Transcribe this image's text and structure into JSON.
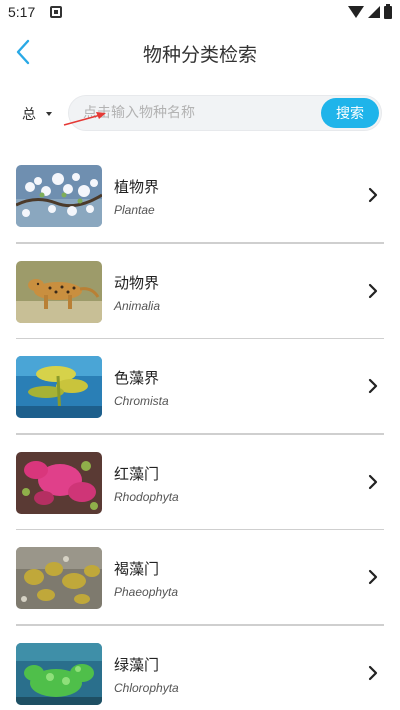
{
  "status_bar": {
    "time": "5:17"
  },
  "header": {
    "title": "物种分类检索"
  },
  "search": {
    "scope_label": "总",
    "placeholder": "点击输入物种名称",
    "button_label": "搜索"
  },
  "items": [
    {
      "name_cn": "植物界",
      "name_latin": "Plantae",
      "image": "plant-blossom"
    },
    {
      "name_cn": "动物界",
      "name_latin": "Animalia",
      "image": "leopard"
    },
    {
      "name_cn": "色藻界",
      "name_latin": "Chromista",
      "image": "kelp"
    },
    {
      "name_cn": "红藻门",
      "name_latin": "Rhodophyta",
      "image": "red-algae"
    },
    {
      "name_cn": "褐藻门",
      "name_latin": "Phaeophyta",
      "image": "brown-algae"
    },
    {
      "name_cn": "绿藻门",
      "name_latin": "Chlorophyta",
      "image": "green-algae"
    }
  ],
  "colors": {
    "accent": "#1fb4ea",
    "back_arrow": "#29a9e6",
    "annotation_arrow": "#e53935"
  }
}
